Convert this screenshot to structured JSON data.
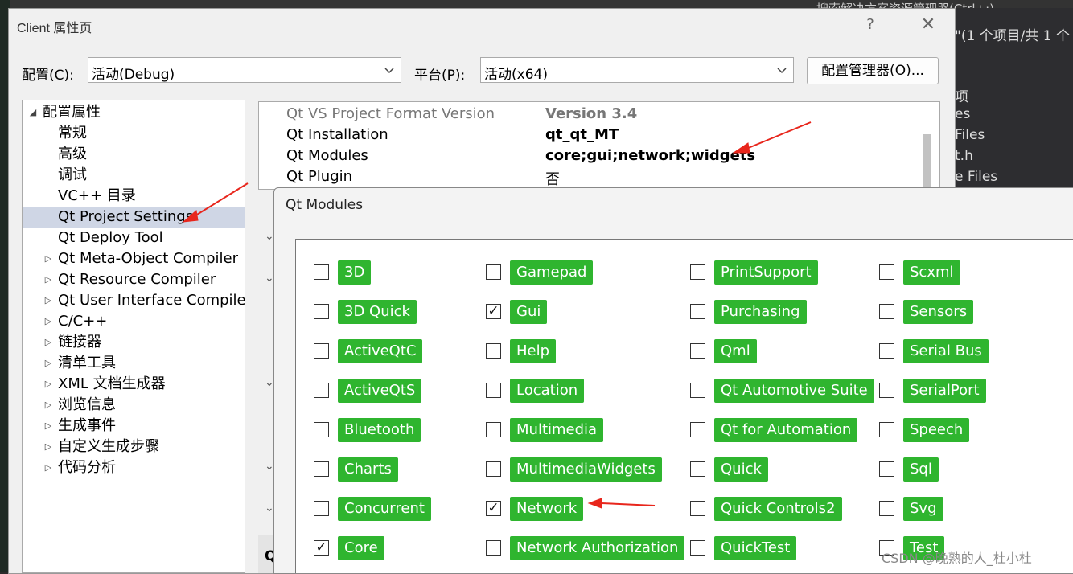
{
  "background": {
    "top_right_text": "搜索解决方案资源管理器(Ctrl+;)",
    "right_panel": [
      "\"(1 个项目/共 1 个",
      "项",
      "es",
      "Files",
      "t.h",
      "e Files"
    ]
  },
  "dialog": {
    "title": "Client 属性页",
    "help_label": "?",
    "close_label": "✕",
    "config_label": "配置(C):",
    "config_value": "活动(Debug)",
    "platform_label": "平台(P):",
    "platform_value": "活动(x64)",
    "config_manager_label": "配置管理器(O)..."
  },
  "tree": {
    "root": "配置属性",
    "items": [
      {
        "label": "常规",
        "expandable": false
      },
      {
        "label": "高级",
        "expandable": false
      },
      {
        "label": "调试",
        "expandable": false
      },
      {
        "label": "VC++ 目录",
        "expandable": false
      },
      {
        "label": "Qt Project Settings",
        "expandable": false,
        "selected": true
      },
      {
        "label": "Qt Deploy Tool",
        "expandable": false
      },
      {
        "label": "Qt Meta-Object Compiler",
        "expandable": true
      },
      {
        "label": "Qt Resource Compiler",
        "expandable": true
      },
      {
        "label": "Qt User Interface Compiler",
        "expandable": true
      },
      {
        "label": "C/C++",
        "expandable": true
      },
      {
        "label": "链接器",
        "expandable": true
      },
      {
        "label": "清单工具",
        "expandable": true
      },
      {
        "label": "XML 文档生成器",
        "expandable": true
      },
      {
        "label": "浏览信息",
        "expandable": true
      },
      {
        "label": "生成事件",
        "expandable": true
      },
      {
        "label": "自定义生成步骤",
        "expandable": true
      },
      {
        "label": "代码分析",
        "expandable": true
      }
    ]
  },
  "properties": [
    {
      "name": "Qt VS Project Format Version",
      "value": "Version 3.4",
      "dim": true,
      "bold": true
    },
    {
      "name": "Qt Installation",
      "value": "qt_qt_MT",
      "dim": false,
      "bold": true
    },
    {
      "name": "Qt Modules",
      "value": "core;gui;network;widgets",
      "dim": false,
      "bold": true
    },
    {
      "name": "Qt Plugin",
      "value": "否",
      "dim": false,
      "bold": false
    }
  ],
  "grid_fragment": "Qt",
  "modules_popup": {
    "title": "Qt Modules",
    "columns": [
      [
        {
          "name": "3D",
          "checked": false
        },
        {
          "name": "3D Quick",
          "checked": false
        },
        {
          "name": "ActiveQtC",
          "checked": false
        },
        {
          "name": "ActiveQtS",
          "checked": false
        },
        {
          "name": "Bluetooth",
          "checked": false
        },
        {
          "name": "Charts",
          "checked": false
        },
        {
          "name": "Concurrent",
          "checked": false
        },
        {
          "name": "Core",
          "checked": true
        }
      ],
      [
        {
          "name": "Gamepad",
          "checked": false
        },
        {
          "name": "Gui",
          "checked": true
        },
        {
          "name": "Help",
          "checked": false
        },
        {
          "name": "Location",
          "checked": false
        },
        {
          "name": "Multimedia",
          "checked": false
        },
        {
          "name": "MultimediaWidgets",
          "checked": false
        },
        {
          "name": "Network",
          "checked": true
        },
        {
          "name": "Network Authorization",
          "checked": false
        }
      ],
      [
        {
          "name": "PrintSupport",
          "checked": false
        },
        {
          "name": "Purchasing",
          "checked": false
        },
        {
          "name": "Qml",
          "checked": false
        },
        {
          "name": "Qt Automotive Suite",
          "checked": false
        },
        {
          "name": "Qt for Automation",
          "checked": false
        },
        {
          "name": "Quick",
          "checked": false
        },
        {
          "name": "Quick Controls2",
          "checked": false
        },
        {
          "name": "QuickTest",
          "checked": false
        }
      ],
      [
        {
          "name": "Scxml",
          "checked": false
        },
        {
          "name": "Sensors",
          "checked": false
        },
        {
          "name": "Serial Bus",
          "checked": false
        },
        {
          "name": "SerialPort",
          "checked": false
        },
        {
          "name": "Speech",
          "checked": false
        },
        {
          "name": "Sql",
          "checked": false
        },
        {
          "name": "Svg",
          "checked": false
        },
        {
          "name": "Test",
          "checked": false
        }
      ]
    ]
  },
  "colors": {
    "module_tag": "#2fb52f",
    "selection": "#cfd6e5",
    "annotation_arrow": "#e8261c"
  },
  "watermark": "CSDN @晚熟的人_杜小杜"
}
